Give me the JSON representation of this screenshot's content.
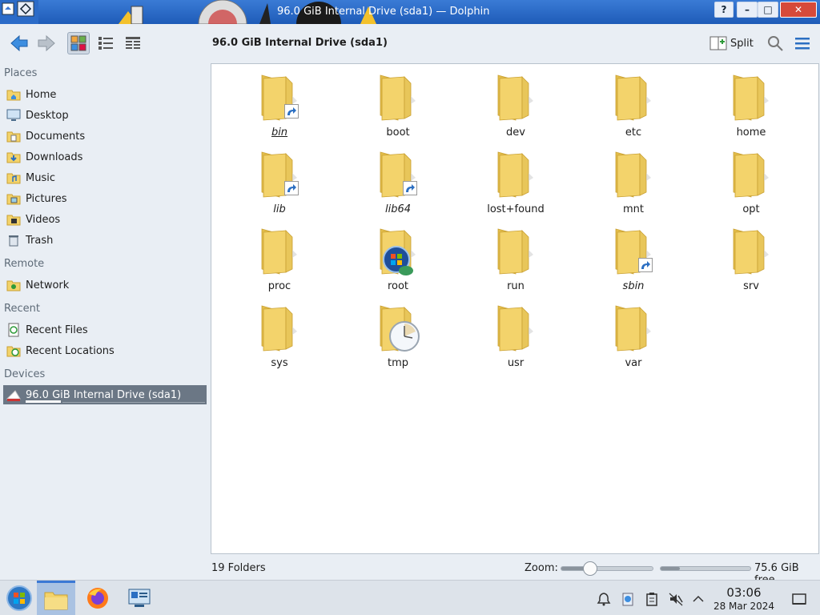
{
  "window": {
    "title": "96.0 GiB Internal Drive (sda1) — Dolphin",
    "help_label": "?",
    "minimize_label": "–",
    "maximize_label": "□",
    "close_label": "✕"
  },
  "toolbar": {
    "location_title": "96.0 GiB Internal Drive (sda1)",
    "split_label": "Split"
  },
  "sidebar": {
    "places_header": "Places",
    "places": [
      {
        "label": "Home",
        "icon": "home-folder-icon"
      },
      {
        "label": "Desktop",
        "icon": "desktop-icon"
      },
      {
        "label": "Documents",
        "icon": "documents-folder-icon"
      },
      {
        "label": "Downloads",
        "icon": "downloads-folder-icon"
      },
      {
        "label": "Music",
        "icon": "music-folder-icon"
      },
      {
        "label": "Pictures",
        "icon": "pictures-folder-icon"
      },
      {
        "label": "Videos",
        "icon": "videos-folder-icon"
      },
      {
        "label": "Trash",
        "icon": "trash-icon"
      }
    ],
    "remote_header": "Remote",
    "remote": [
      {
        "label": "Network",
        "icon": "network-folder-icon"
      }
    ],
    "recent_header": "Recent",
    "recent": [
      {
        "label": "Recent Files",
        "icon": "recent-files-icon"
      },
      {
        "label": "Recent Locations",
        "icon": "recent-locations-icon"
      }
    ],
    "devices_header": "Devices",
    "devices": [
      {
        "label": "96.0 GiB Internal Drive (sda1)",
        "icon": "drive-icon"
      }
    ]
  },
  "folders": [
    {
      "name": "bin",
      "symlink": true
    },
    {
      "name": "boot",
      "symlink": false
    },
    {
      "name": "dev",
      "symlink": false
    },
    {
      "name": "etc",
      "symlink": false
    },
    {
      "name": "home",
      "symlink": false
    },
    {
      "name": "lib",
      "symlink": true
    },
    {
      "name": "lib64",
      "symlink": true
    },
    {
      "name": "lost+found",
      "symlink": false
    },
    {
      "name": "mnt",
      "symlink": false
    },
    {
      "name": "opt",
      "symlink": false
    },
    {
      "name": "proc",
      "symlink": false
    },
    {
      "name": "root",
      "symlink": false,
      "overlay": "windows-logo-icon"
    },
    {
      "name": "run",
      "symlink": false
    },
    {
      "name": "sbin",
      "symlink": true
    },
    {
      "name": "srv",
      "symlink": false
    },
    {
      "name": "sys",
      "symlink": false
    },
    {
      "name": "tmp",
      "symlink": false,
      "overlay": "clock-icon"
    },
    {
      "name": "usr",
      "symlink": false
    },
    {
      "name": "var",
      "symlink": false
    }
  ],
  "statusbar": {
    "folder_count": "19 Folders",
    "zoom_label": "Zoom:",
    "zoom_level": 0.28,
    "free_space": "75.6 GiB free",
    "used_fraction": 0.21
  },
  "clock": {
    "time": "03:06",
    "date": "28 Mar 2024"
  },
  "colors": {
    "folder_fill": "#f3d36b",
    "folder_shade": "#e3bd4a",
    "selection": "#6b7785",
    "accent": "#3b78d4"
  }
}
